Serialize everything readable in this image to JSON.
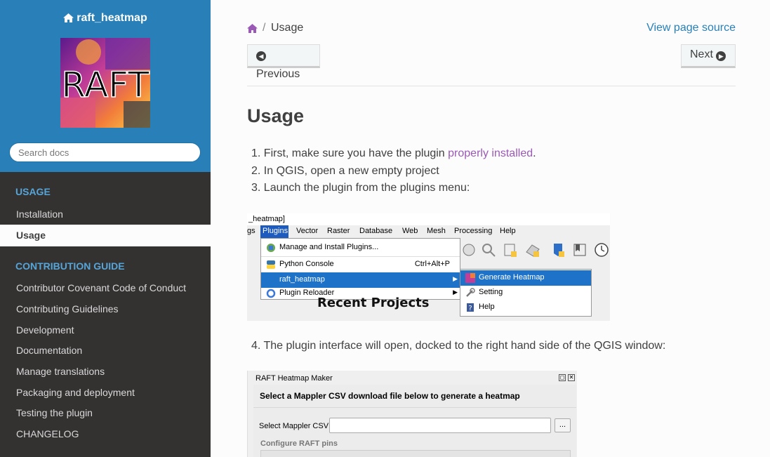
{
  "sidebar": {
    "project_name": "raft_heatmap",
    "logo_text": "RAFT",
    "search_placeholder": "Search docs",
    "sections": [
      {
        "caption": "USAGE",
        "items": [
          {
            "label": "Installation"
          },
          {
            "label": "Usage",
            "current": true
          }
        ]
      },
      {
        "caption": "CONTRIBUTION GUIDE",
        "items": [
          {
            "label": "Contributor Covenant Code of Conduct"
          },
          {
            "label": "Contributing Guidelines"
          },
          {
            "label": "Development"
          },
          {
            "label": "Documentation"
          },
          {
            "label": "Manage translations"
          },
          {
            "label": "Packaging and deployment"
          },
          {
            "label": "Testing the plugin"
          },
          {
            "label": "CHANGELOG"
          }
        ]
      }
    ]
  },
  "breadcrumb": {
    "current": "Usage",
    "separator": "/"
  },
  "view_source": "View page source",
  "nav_buttons": {
    "previous": "Previous",
    "next": "Next"
  },
  "page": {
    "title": "Usage",
    "steps": [
      {
        "num": "1.",
        "prefix": "First, make sure you have the plugin ",
        "link": "properly installed",
        "suffix": "."
      },
      {
        "num": "2.",
        "text": "In QGIS, open a new empty project"
      },
      {
        "num": "3.",
        "text": "Launch the plugin from the plugins menu:"
      },
      {
        "num": "4.",
        "text": "The plugin interface will open, docked to the right hand side of the QGIS window:"
      }
    ]
  },
  "screenshot1": {
    "title": "_heatmap]",
    "menubar": [
      "gs",
      "Plugins",
      "Vector",
      "Raster",
      "Database",
      "Web",
      "Mesh",
      "Processing",
      "Help"
    ],
    "menu_items": [
      {
        "label": "Manage and Install Plugins...",
        "shortcut": ""
      },
      {
        "label": "Python Console",
        "shortcut": "Ctrl+Alt+P"
      },
      {
        "label": "raft_heatmap",
        "shortcut": ""
      },
      {
        "label": "Plugin Reloader",
        "shortcut": ""
      }
    ],
    "submenu_items": [
      "Generate Heatmap",
      "Setting",
      "Help"
    ],
    "recent_projects": "Recent Projects"
  },
  "screenshot2": {
    "window_title": "RAFT Heatmap Maker",
    "heading": "Select a Mappler CSV download file below to generate a heatmap",
    "field_label": "Select Mappler CSV",
    "browse_label": "...",
    "section_label": "Configure RAFT pins"
  },
  "colors": {
    "sidebar_top": "#2980b9",
    "sidebar_bg": "#343131",
    "caption": "#55a5d9",
    "link": "#9b59b6",
    "view_source": "#2980b9",
    "menu_highlight": "#1e73c9"
  }
}
